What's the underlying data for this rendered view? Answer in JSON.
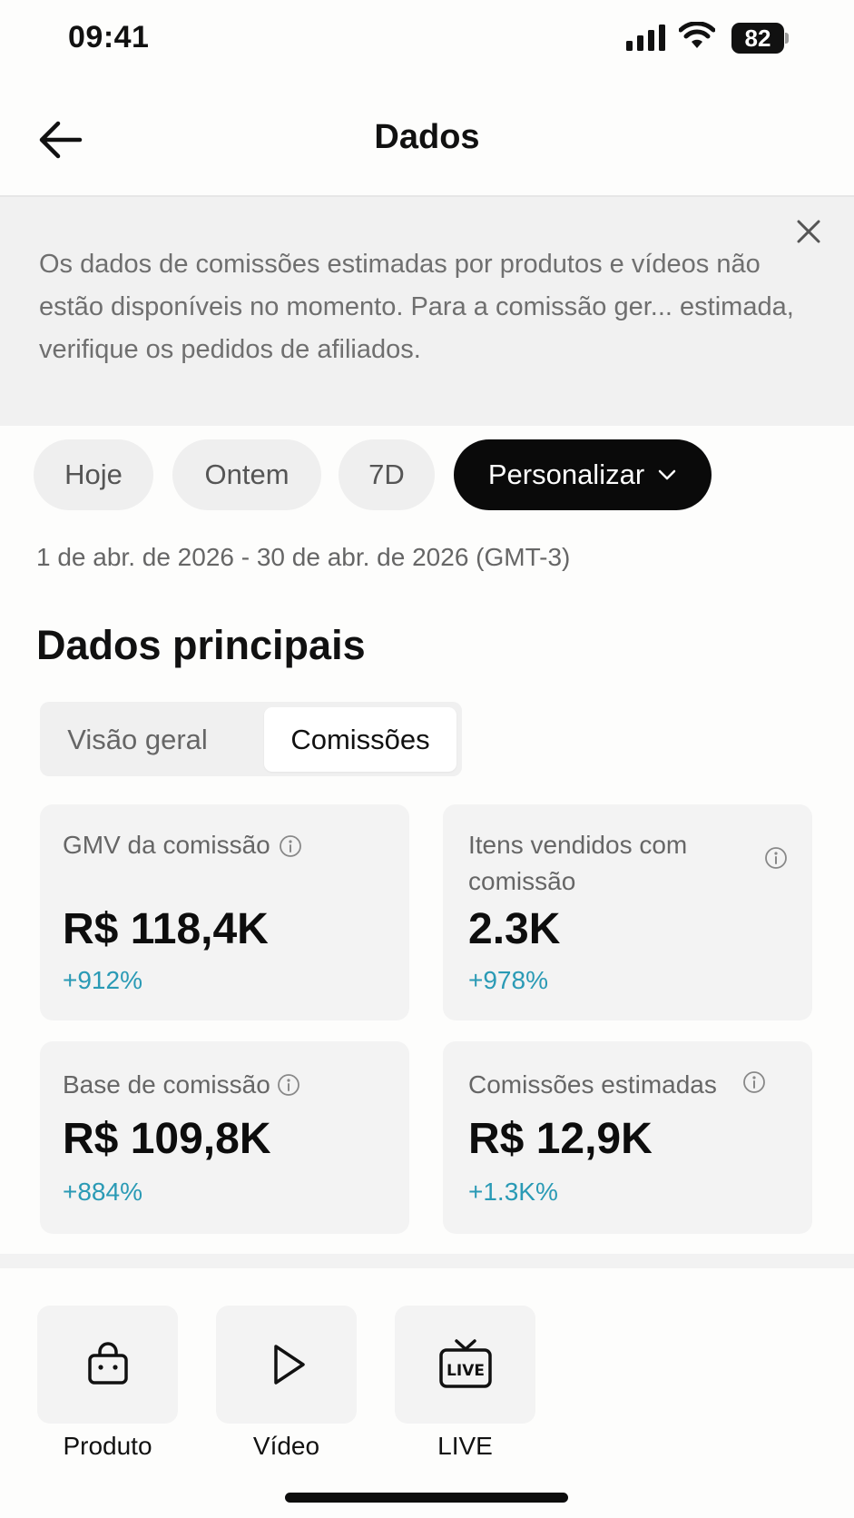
{
  "status_bar": {
    "time": "09:41",
    "battery": "82"
  },
  "header": {
    "title": "Dados"
  },
  "banner": {
    "text": "Os dados de comissões estimadas por produtos e vídeos não estão disponíveis no momento. Para a comissão ger... estimada, verifique os pedidos de afiliados."
  },
  "period": {
    "chips": [
      "Hoje",
      "Ontem",
      "7D",
      "Personalizar"
    ],
    "selected": "Personalizar",
    "range": "1 de abr. de 2026 - 30 de abr. de 2026 (GMT-3)"
  },
  "main": {
    "title": "Dados principais",
    "tabs": [
      "Visão geral",
      "Comissões"
    ],
    "active_tab": "Comissões",
    "metrics": [
      {
        "label": "GMV da comissão",
        "value": "R$ 118,4K",
        "delta": "+912%"
      },
      {
        "label": "Itens vendidos com comissão",
        "value": "2.3K",
        "delta": "+978%"
      },
      {
        "label": "Base de comissão",
        "value": "R$ 109,8K",
        "delta": "+884%"
      },
      {
        "label": "Comissões estimadas",
        "value": "R$ 12,9K",
        "delta": "+1.3K%"
      }
    ]
  },
  "bottom_nav": {
    "items": [
      {
        "label": "Produto",
        "icon": "shopping-bag-icon"
      },
      {
        "label": "Vídeo",
        "icon": "play-icon"
      },
      {
        "label": "LIVE",
        "icon": "live-tv-icon"
      }
    ]
  },
  "colors": {
    "accent_delta": "#2a9ab5",
    "selected_chip": "#0a0a0a",
    "card_bg": "#f3f3f3"
  }
}
